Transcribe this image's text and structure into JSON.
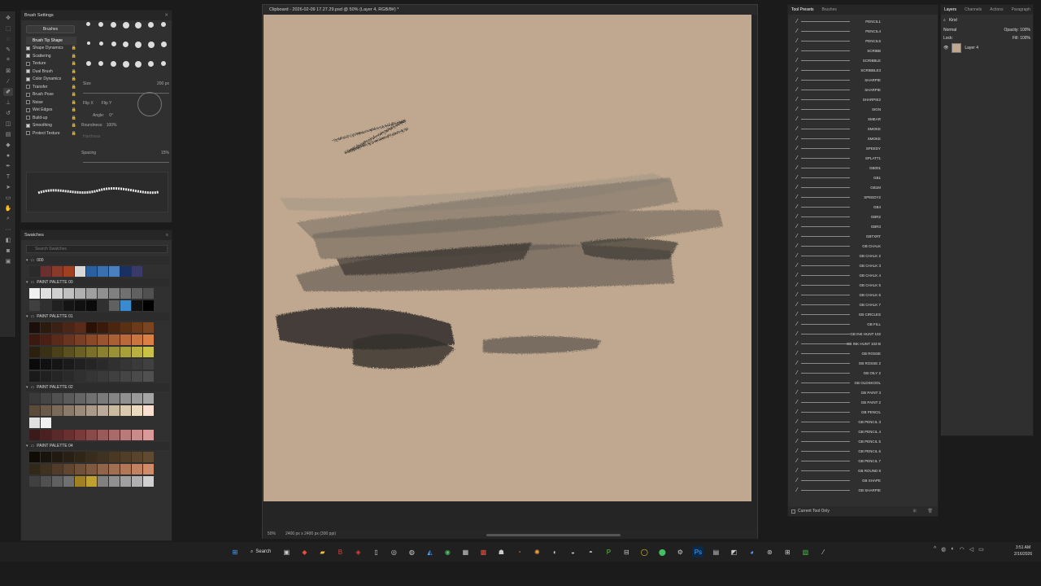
{
  "brush_settings": {
    "title": "Brush Settings",
    "brushes_button": "Brushes",
    "options": [
      {
        "label": "Brush Tip Shape",
        "checked": null,
        "selected": true
      },
      {
        "label": "Shape Dynamics",
        "checked": true
      },
      {
        "label": "Scattering",
        "checked": true
      },
      {
        "label": "Texture",
        "checked": false
      },
      {
        "label": "Dual Brush",
        "checked": true
      },
      {
        "label": "Color Dynamics",
        "checked": true
      },
      {
        "label": "Transfer",
        "checked": false
      },
      {
        "label": "Brush Pose",
        "checked": false
      },
      {
        "label": "Noise",
        "checked": false
      },
      {
        "label": "Wet Edges",
        "checked": false
      },
      {
        "label": "Build-up",
        "checked": false
      },
      {
        "label": "Smoothing",
        "checked": true
      },
      {
        "label": "Protect Texture",
        "checked": false
      }
    ],
    "size_label": "Size",
    "size_value": "200 px",
    "flip_x": "Flip X",
    "flip_y": "Flip Y",
    "angle_label": "Angle:",
    "angle_value": "0°",
    "roundness_label": "Roundness:",
    "roundness_value": "100%",
    "hardness_label": "Hardness",
    "spacing_label": "Spacing",
    "spacing_value": "15%"
  },
  "swatches": {
    "title": "Swatches",
    "search_placeholder": "Search Swatches",
    "folders": [
      "000",
      "PAINT PALETTE 00",
      "PAINT PALETTE 01",
      "PAINT PALETTE 02",
      "PAINT PALETTE 04"
    ]
  },
  "document": {
    "title": "Clipboard - 2026-02-09 17.27.29.psd @ 50% (Layer 4, RGB/8#) *",
    "zoom": "50%",
    "doc_info": "2400 px x 2400 px (300 ppi)",
    "canvas_color": "#bfa88f"
  },
  "tool_presets": {
    "tabs": [
      "Tool Presets",
      "Brushes"
    ],
    "items": [
      "PENCIL1",
      "PENCIL4",
      "PENCIL5",
      "SCRIBB",
      "SCRIBBLE",
      "SCRIBBLE3",
      "SHARPIE",
      "SHARPIE",
      "SHARPIE2",
      "SIGN",
      "SMEAR",
      "SMOKE",
      "SMOKE",
      "SPEEDY",
      "SPLATT1",
      "GB001",
      "GB1",
      "GB1M",
      "SPEEDY2",
      "GB4",
      "GBR2",
      "GBR3",
      "GBTXRT",
      "GB CHALK",
      "GB CHALK 2",
      "GB CHALK 3",
      "GB CHALK 4",
      "GB CHALK 5",
      "GB CHALK 6",
      "GB CHALK 7",
      "GB CIRCLES",
      "GB FILL",
      "GB INK HUNT 102",
      "GB INK HUNT 102-B",
      "GB ROSSE",
      "GB ROSSE 2",
      "GB OILY 2",
      "GB OLDSKOOL",
      "GB PAINT 3",
      "GB PAINT 2",
      "GB PENCIL",
      "GB PENCIL 3",
      "GB PENCIL 4",
      "GB PENCIL 5",
      "GB PENCIL 6",
      "GB PENCIL 7",
      "GB ROUND 8",
      "GB SHAPE",
      "GB SHARPIE"
    ],
    "footer": "Current Tool Only"
  },
  "layers": {
    "tabs": [
      "Layers",
      "Channels",
      "Actions",
      "Paragraph"
    ],
    "kind_label": "Kind",
    "blend_mode": "Normal",
    "opacity_label": "Opacity:",
    "opacity_value": "100%",
    "lock_label": "Lock:",
    "fill_label": "Fill:",
    "fill_value": "100%",
    "layer_name": "Layer 4"
  },
  "taskbar": {
    "search_label": "Search",
    "time": "3:51 AM",
    "date": "2/16/2026"
  }
}
